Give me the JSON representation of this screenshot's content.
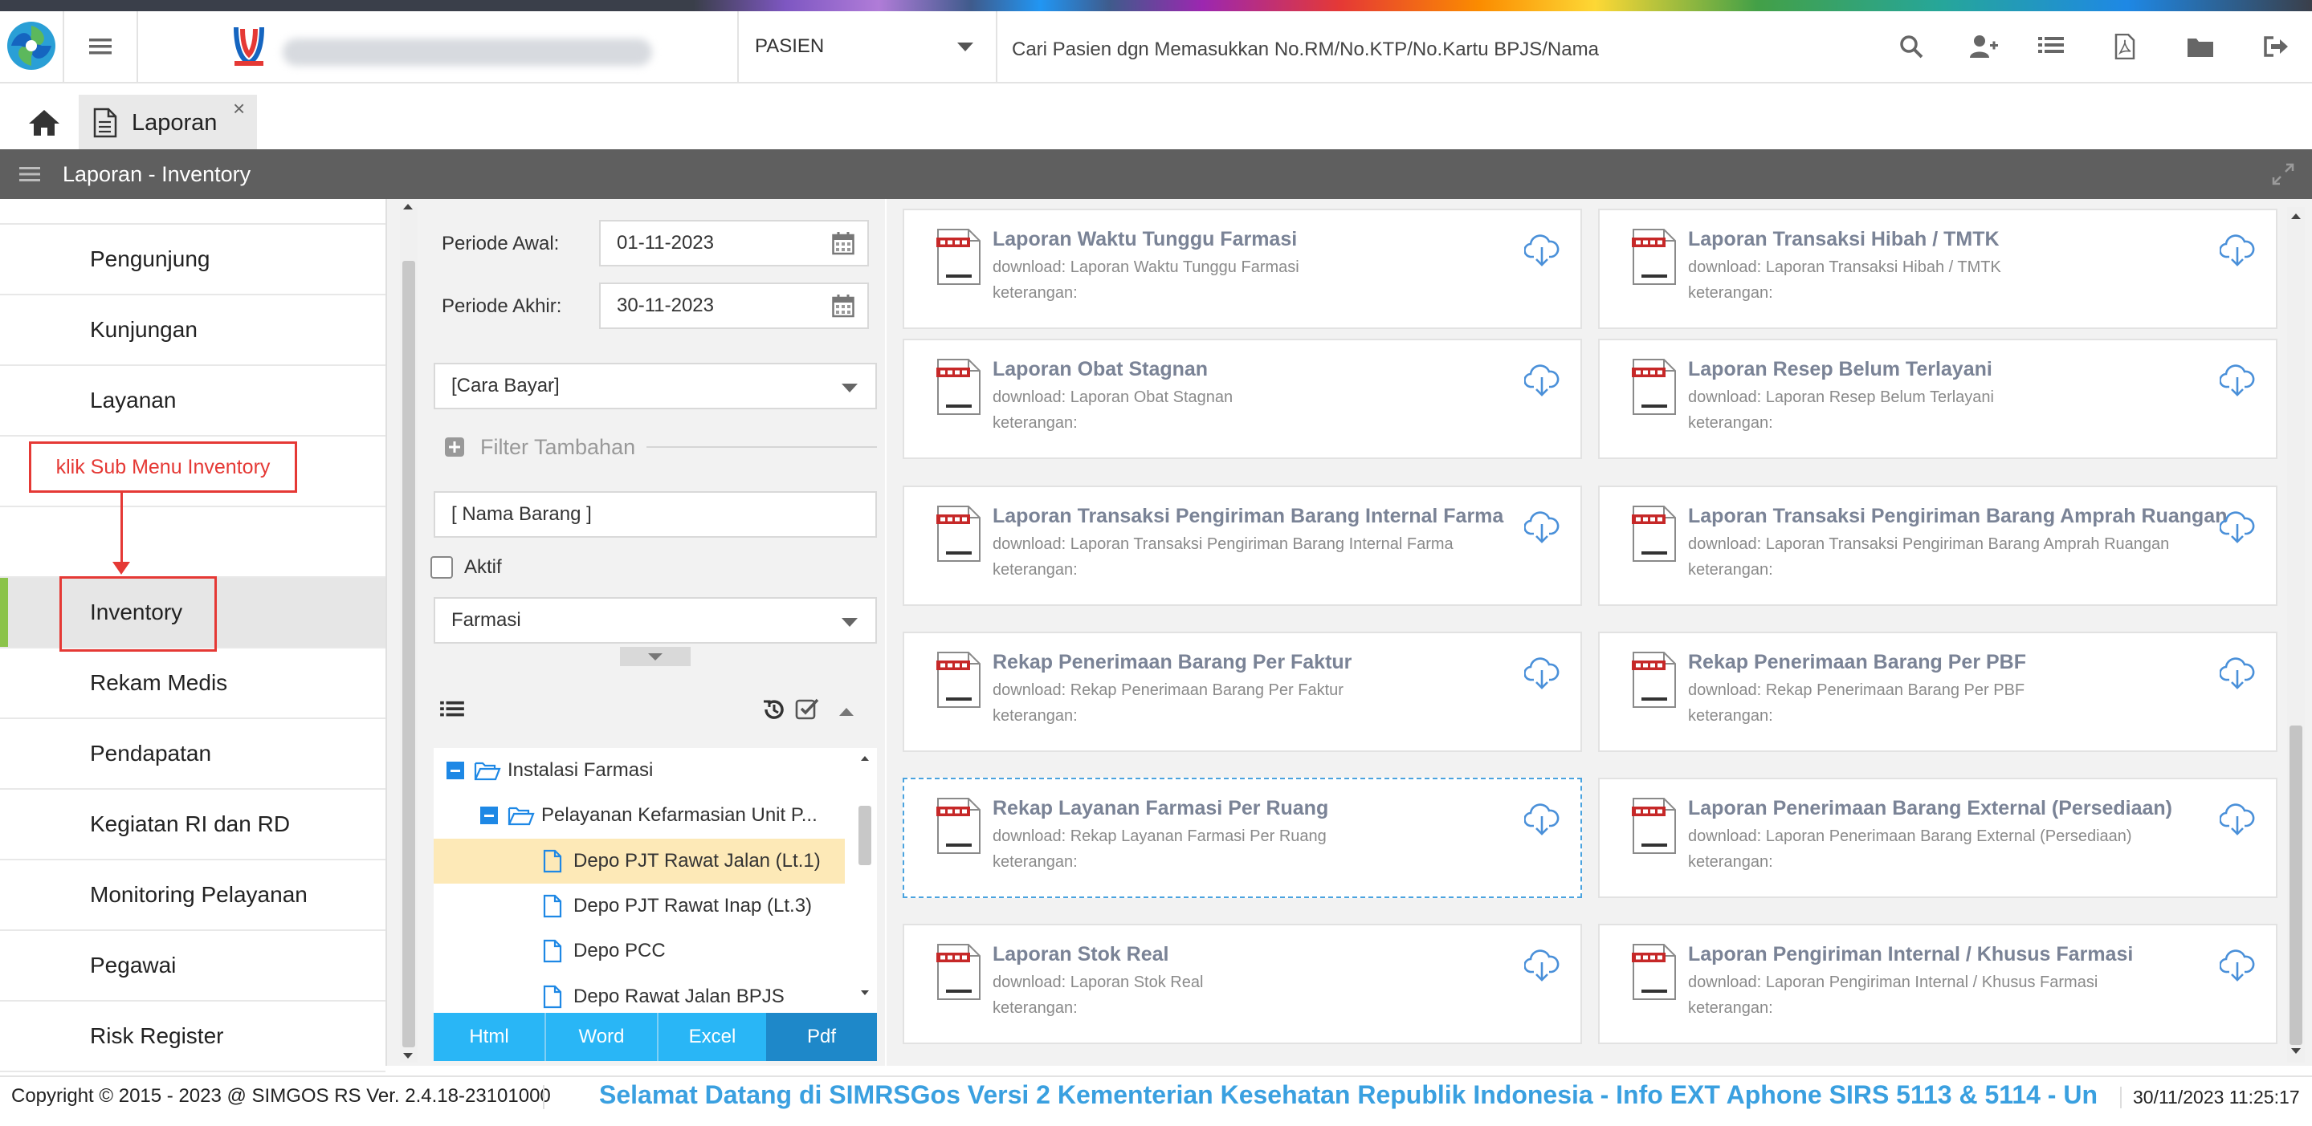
{
  "header": {
    "patient_dropdown_label": "PASIEN",
    "search_placeholder": "Cari Pasien dgn Memasukkan No.RM/No.KTP/No.Kartu BPJS/Nama",
    "icons": [
      "search-icon",
      "add-user-icon",
      "list-icon",
      "pdf-icon",
      "folder-icon",
      "logout-icon"
    ]
  },
  "tabs": [
    {
      "label": "Laporan",
      "close": "×"
    }
  ],
  "panel_title": "Laporan - Inventory",
  "sidebar": {
    "items": [
      {
        "label": "Pengunjung"
      },
      {
        "label": "Kunjungan"
      },
      {
        "label": "Layanan"
      },
      {
        "label": ""
      },
      {
        "label": ""
      },
      {
        "label": "Inventory"
      },
      {
        "label": "Rekam Medis"
      },
      {
        "label": "Pendapatan"
      },
      {
        "label": "Kegiatan RI dan RD"
      },
      {
        "label": "Monitoring Pelayanan"
      },
      {
        "label": "Pegawai"
      },
      {
        "label": "Risk Register"
      }
    ],
    "annotation": "klik Sub Menu Inventory"
  },
  "filters": {
    "periode_awal_label": "Periode Awal:",
    "periode_awal_value": "01-11-2023",
    "periode_akhir_label": "Periode Akhir:",
    "periode_akhir_value": "30-11-2023",
    "cara_bayar": "[Cara Bayar]",
    "filter_tambahan": "Filter Tambahan",
    "nama_barang_placeholder": "[ Nama Barang ]",
    "aktif_label": "Aktif",
    "unit_value": "Farmasi"
  },
  "tree": {
    "items": [
      {
        "label": "Instalasi Farmasi"
      },
      {
        "label": "Pelayanan Kefarmasian Unit P..."
      },
      {
        "label": "Depo PJT Rawat Jalan (Lt.1)"
      },
      {
        "label": "Depo PJT Rawat Inap (Lt.3)"
      },
      {
        "label": "Depo PCC"
      },
      {
        "label": "Depo Rawat Jalan BPJS"
      }
    ]
  },
  "export_buttons": [
    "Html",
    "Word",
    "Excel",
    "Pdf"
  ],
  "reports": [
    {
      "title": "Laporan Waktu Tunggu Farmasi",
      "download": "download: Laporan Waktu Tunggu Farmasi",
      "ket": "keterangan:"
    },
    {
      "title": "Laporan Transaksi Hibah / TMTK",
      "download": "download: Laporan Transaksi Hibah / TMTK",
      "ket": "keterangan:"
    },
    {
      "title": "Laporan Obat Stagnan",
      "download": "download: Laporan Obat Stagnan",
      "ket": "keterangan:"
    },
    {
      "title": "Laporan Resep Belum Terlayani",
      "download": "download: Laporan Resep Belum Terlayani",
      "ket": "keterangan:"
    },
    {
      "title": "Laporan Transaksi Pengiriman Barang Internal Farma",
      "download": "download: Laporan Transaksi Pengiriman Barang Internal Farma",
      "ket": "keterangan:"
    },
    {
      "title": "Laporan Transaksi Pengiriman Barang Amprah Ruangan",
      "download": "download: Laporan Transaksi Pengiriman Barang Amprah Ruangan",
      "ket": "keterangan:"
    },
    {
      "title": "Rekap Penerimaan Barang Per Faktur",
      "download": "download: Rekap Penerimaan Barang Per Faktur",
      "ket": "keterangan:"
    },
    {
      "title": "Rekap Penerimaan Barang Per PBF",
      "download": "download: Rekap Penerimaan Barang Per PBF",
      "ket": "keterangan:"
    },
    {
      "title": "Rekap Layanan Farmasi Per Ruang",
      "download": "download: Rekap Layanan Farmasi Per Ruang",
      "ket": "keterangan:"
    },
    {
      "title": "Laporan Penerimaan Barang External (Persediaan)",
      "download": "download: Laporan Penerimaan Barang External (Persediaan)",
      "ket": "keterangan:"
    },
    {
      "title": "Laporan Stok Real",
      "download": "download: Laporan Stok Real",
      "ket": "keterangan:"
    },
    {
      "title": "Laporan Pengiriman Internal / Khusus Farmasi",
      "download": "download: Laporan Pengiriman Internal / Khusus Farmasi",
      "ket": "keterangan:"
    }
  ],
  "footer": {
    "copyright": "Copyright © 2015 - 2023 @ SIMGOS RS Ver. 2.4.18-23101000",
    "marquee": "Selamat Datang di SIMRSGos Versi 2 Kementerian Kesehatan Republik Indonesia - Info EXT Aphone SIRS 5113 & 5114 - Un",
    "datetime": "30/11/2023 11:25:17"
  },
  "colors": {
    "accent": "#29b6f6",
    "export_pdf": "#1e88c9",
    "panel_bar": "#5f5f5f",
    "annotation": "#e53935",
    "active_marker": "#8bc34a"
  }
}
